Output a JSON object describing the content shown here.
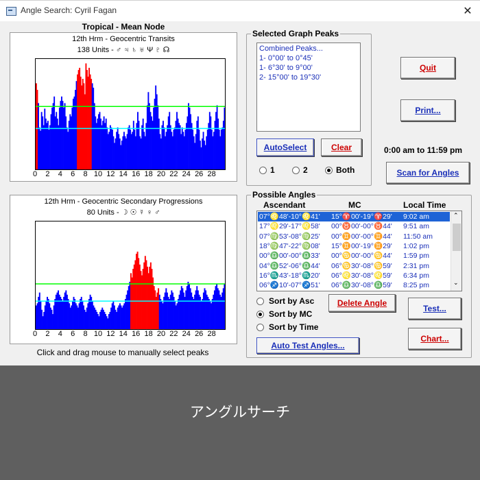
{
  "window": {
    "title": "Angle Search: Cyril Fagan",
    "close_glyph": "✕"
  },
  "header": {
    "zodiac": "Tropical - Mean Node"
  },
  "graph_top": {
    "title": "12th Hrm - Geocentric Transits",
    "units": "138 Units - ♂ ♃ ♄ ♅ Ψ ♇ ☊",
    "ticks": [
      "0",
      "2",
      "4",
      "6",
      "8",
      "10",
      "12",
      "14",
      "16",
      "18",
      "20",
      "22",
      "24",
      "26",
      "28"
    ],
    "colors": {
      "bar": "#0000ff",
      "peak": "#ff0000",
      "green": "#00ff00",
      "cyan": "#00ffff"
    }
  },
  "graph_bottom": {
    "title": "12th Hrm - Geocentric Secondary Progressions",
    "units": "80 Units - ☽ ☉ ☿ ♀ ♂",
    "ticks": [
      "0",
      "2",
      "4",
      "6",
      "8",
      "10",
      "12",
      "14",
      "16",
      "18",
      "20",
      "22",
      "24",
      "26",
      "28"
    ]
  },
  "hint": "Click and drag mouse to manually select peaks",
  "chart_data": [
    {
      "type": "bar",
      "xlim": [
        0,
        30
      ],
      "ylim": [
        0,
        100
      ],
      "green_line": 57,
      "cyan_line": 37,
      "values": [
        78,
        72,
        60,
        38,
        35,
        52,
        48,
        40,
        55,
        46,
        42,
        44,
        36,
        40,
        50,
        56,
        60,
        66,
        48,
        52,
        46,
        40,
        56,
        62,
        66,
        62,
        56,
        60,
        48,
        38,
        34,
        44,
        50,
        48,
        56,
        64,
        66,
        72,
        80,
        86,
        90,
        92,
        84,
        76,
        82,
        78,
        68,
        96,
        90,
        84,
        92,
        86,
        82,
        78,
        74,
        60,
        48,
        42,
        46,
        50,
        52,
        46,
        40,
        44,
        48,
        42,
        46,
        38,
        32,
        34,
        40,
        38,
        36,
        30,
        24,
        28,
        34,
        38,
        32,
        28,
        22,
        26,
        30,
        34,
        30,
        28,
        32,
        38,
        40,
        36,
        32,
        34,
        44,
        36,
        30,
        42,
        52,
        44,
        30,
        28,
        40,
        46,
        34,
        30,
        42,
        58,
        70,
        60,
        52,
        48,
        44,
        56,
        64,
        76,
        68,
        58,
        46,
        32,
        28,
        40,
        44,
        38,
        30,
        34,
        40,
        48,
        52,
        40,
        34,
        30,
        36,
        38,
        44,
        52,
        46,
        42,
        40,
        32,
        38,
        34,
        30,
        36,
        42,
        48,
        60,
        56,
        50,
        42,
        36,
        30,
        24,
        32,
        44,
        48,
        36,
        26,
        20,
        28,
        34,
        26,
        22,
        30,
        36,
        42,
        52,
        48,
        36,
        30,
        34,
        44,
        52,
        58,
        46,
        36,
        30,
        36,
        38,
        44,
        56
      ],
      "peaks": [
        [
          0,
          0.3
        ],
        [
          6.55,
          8.8
        ]
      ]
    },
    {
      "type": "bar",
      "xlim": [
        0,
        30
      ],
      "ylim": [
        0,
        100
      ],
      "green_line": 42,
      "cyan_line": 26,
      "values": [
        22,
        24,
        30,
        34,
        26,
        18,
        12,
        16,
        22,
        26,
        30,
        28,
        24,
        20,
        18,
        14,
        22,
        28,
        32,
        34,
        36,
        32,
        30,
        28,
        26,
        30,
        34,
        36,
        32,
        28,
        24,
        20,
        22,
        26,
        30,
        28,
        24,
        22,
        20,
        24,
        28,
        30,
        26,
        22,
        18,
        16,
        20,
        24,
        28,
        32,
        30,
        26,
        22,
        20,
        18,
        16,
        14,
        12,
        16,
        18,
        20,
        18,
        16,
        14,
        12,
        10,
        14,
        16,
        20,
        24,
        26,
        22,
        18,
        16,
        20,
        22,
        24,
        22,
        20,
        22,
        24,
        28,
        32,
        36,
        40,
        44,
        52,
        48,
        56,
        60,
        64,
        70,
        72,
        66,
        60,
        54,
        50,
        56,
        62,
        68,
        64,
        58,
        52,
        58,
        62,
        56,
        48,
        40,
        36,
        30,
        34,
        38,
        32,
        28,
        26,
        24,
        30,
        34,
        38,
        34,
        30,
        28,
        32,
        36,
        34,
        30,
        26,
        22,
        24,
        28,
        32,
        36,
        40,
        38,
        34,
        30,
        36,
        40,
        44,
        42,
        38,
        34,
        30,
        28,
        32,
        36,
        40,
        36,
        32,
        30,
        26,
        28,
        34,
        38,
        36,
        32,
        30,
        28,
        26,
        24,
        28,
        32,
        36,
        40,
        42,
        38,
        36,
        32,
        30,
        34,
        38,
        42
      ],
      "peaks": [
        [
          15.05,
          19.5
        ]
      ]
    }
  ],
  "selected_peaks": {
    "title": "Selected Graph Peaks",
    "items": [
      "Combined Peaks...",
      "1-  0°00' to 0°45'",
      "1-  6°30' to 9°00'",
      "2-  15°00' to 19°30'"
    ]
  },
  "buttons": {
    "quit": "Quit",
    "print": "Print...",
    "autoselect": "AutoSelect",
    "clear": "Clear",
    "scan": "Scan for Angles",
    "delete_angle": "Delete Angle",
    "test": "Test...",
    "chart": "Chart...",
    "auto_test": "Auto Test Angles..."
  },
  "time_range": "0:00 am to 11:59 pm",
  "harmonic_radios": [
    {
      "label": "1",
      "checked": false
    },
    {
      "label": "2",
      "checked": false
    },
    {
      "label": "Both",
      "checked": true
    }
  ],
  "possible_angles": {
    "title": "Possible Angles",
    "headers": [
      "Ascendant",
      "MC",
      "Local Time"
    ],
    "rows": [
      {
        "asc": "07°♌48'-10°♌41'",
        "mc": "15°♈00'-19°♈29'",
        "time": "9:02 am",
        "selected": true
      },
      {
        "asc": "17°♌29'-17°♌58'",
        "mc": "00°♉00'-00°♉44'",
        "time": "9:51 am",
        "selected": false
      },
      {
        "asc": "07°♍53'-08°♍25'",
        "mc": "00°♊00'-00°♊44'",
        "time": "11:50 am",
        "selected": false
      },
      {
        "asc": "18°♍47'-22°♍08'",
        "mc": "15°♊00'-19°♊29'",
        "time": "1:02 pm",
        "selected": false
      },
      {
        "asc": "00°♎00'-00°♎33'",
        "mc": "00°♋00'-00°♋44'",
        "time": "1:59 pm",
        "selected": false
      },
      {
        "asc": "04°♎52'-06°♎44'",
        "mc": "06°♋30'-08°♋59'",
        "time": "2:31 pm",
        "selected": false
      },
      {
        "asc": "16°♏43'-18°♏20'",
        "mc": "06°♌30'-08°♌59'",
        "time": "6:34 pm",
        "selected": false
      },
      {
        "asc": "06°♐10'-07°♐51'",
        "mc": "06°♎30'-08°♎59'",
        "time": "8:25 pm",
        "selected": false
      }
    ]
  },
  "sort_radios": [
    {
      "label": "Sort by Asc",
      "checked": false
    },
    {
      "label": "Sort by MC",
      "checked": true
    },
    {
      "label": "Sort by Time",
      "checked": false
    }
  ],
  "caption": "アングルサーチ"
}
